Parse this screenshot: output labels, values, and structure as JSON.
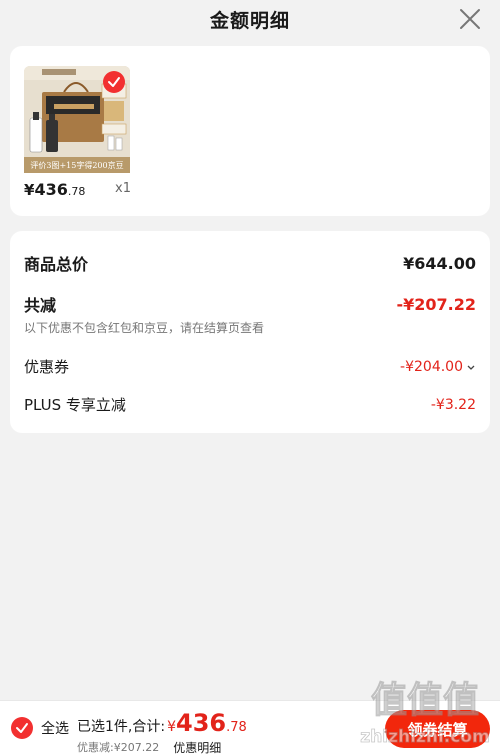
{
  "header": {
    "title": "金额明细"
  },
  "product": {
    "image_banner": "评价3图+15字得200京豆",
    "price_symbol": "¥",
    "price_int": "436",
    "price_dec": ".78",
    "quantity": "x1"
  },
  "summary": {
    "total_label": "商品总价",
    "total_value": "¥644.00",
    "reduce_label": "共减",
    "reduce_value": "-¥207.22",
    "note": "以下优惠不包含红包和京豆，请在结算页查看",
    "coupon_label": "优惠券",
    "coupon_value": "-¥204.00",
    "plus_label": "PLUS 专享立减",
    "plus_value": "-¥3.22"
  },
  "bottom": {
    "select_all": "全选",
    "selected_text": "已选1件,合计:",
    "amount_symbol": "¥",
    "amount_int": "436",
    "amount_dec": ".78",
    "discount_text": "优惠减:¥207.22",
    "detail_link": "优惠明细",
    "checkout_button": "领券结算"
  },
  "watermark": {
    "text": "值值值",
    "url": "zhizhizhi.com"
  },
  "colors": {
    "accent": "#f2270c",
    "red_text": "#e2231a",
    "background": "#f2f2f2"
  }
}
